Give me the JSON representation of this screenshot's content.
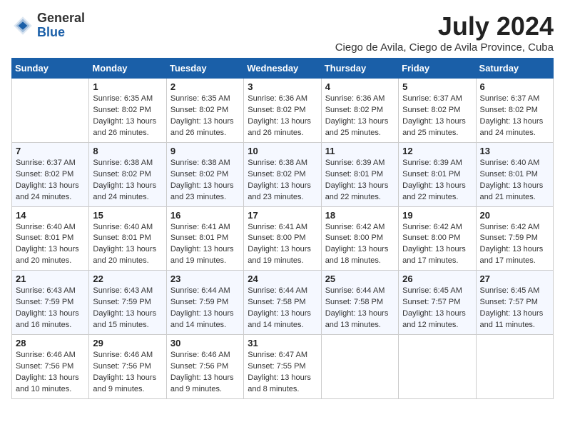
{
  "logo": {
    "general": "General",
    "blue": "Blue"
  },
  "title": "July 2024",
  "subtitle": "Ciego de Avila, Ciego de Avila Province, Cuba",
  "calendar": {
    "headers": [
      "Sunday",
      "Monday",
      "Tuesday",
      "Wednesday",
      "Thursday",
      "Friday",
      "Saturday"
    ],
    "weeks": [
      [
        {
          "day": "",
          "sunrise": "",
          "sunset": "",
          "daylight": ""
        },
        {
          "day": "1",
          "sunrise": "Sunrise: 6:35 AM",
          "sunset": "Sunset: 8:02 PM",
          "daylight": "Daylight: 13 hours and 26 minutes."
        },
        {
          "day": "2",
          "sunrise": "Sunrise: 6:35 AM",
          "sunset": "Sunset: 8:02 PM",
          "daylight": "Daylight: 13 hours and 26 minutes."
        },
        {
          "day": "3",
          "sunrise": "Sunrise: 6:36 AM",
          "sunset": "Sunset: 8:02 PM",
          "daylight": "Daylight: 13 hours and 26 minutes."
        },
        {
          "day": "4",
          "sunrise": "Sunrise: 6:36 AM",
          "sunset": "Sunset: 8:02 PM",
          "daylight": "Daylight: 13 hours and 25 minutes."
        },
        {
          "day": "5",
          "sunrise": "Sunrise: 6:37 AM",
          "sunset": "Sunset: 8:02 PM",
          "daylight": "Daylight: 13 hours and 25 minutes."
        },
        {
          "day": "6",
          "sunrise": "Sunrise: 6:37 AM",
          "sunset": "Sunset: 8:02 PM",
          "daylight": "Daylight: 13 hours and 24 minutes."
        }
      ],
      [
        {
          "day": "7",
          "sunrise": "Sunrise: 6:37 AM",
          "sunset": "Sunset: 8:02 PM",
          "daylight": "Daylight: 13 hours and 24 minutes."
        },
        {
          "day": "8",
          "sunrise": "Sunrise: 6:38 AM",
          "sunset": "Sunset: 8:02 PM",
          "daylight": "Daylight: 13 hours and 24 minutes."
        },
        {
          "day": "9",
          "sunrise": "Sunrise: 6:38 AM",
          "sunset": "Sunset: 8:02 PM",
          "daylight": "Daylight: 13 hours and 23 minutes."
        },
        {
          "day": "10",
          "sunrise": "Sunrise: 6:38 AM",
          "sunset": "Sunset: 8:02 PM",
          "daylight": "Daylight: 13 hours and 23 minutes."
        },
        {
          "day": "11",
          "sunrise": "Sunrise: 6:39 AM",
          "sunset": "Sunset: 8:01 PM",
          "daylight": "Daylight: 13 hours and 22 minutes."
        },
        {
          "day": "12",
          "sunrise": "Sunrise: 6:39 AM",
          "sunset": "Sunset: 8:01 PM",
          "daylight": "Daylight: 13 hours and 22 minutes."
        },
        {
          "day": "13",
          "sunrise": "Sunrise: 6:40 AM",
          "sunset": "Sunset: 8:01 PM",
          "daylight": "Daylight: 13 hours and 21 minutes."
        }
      ],
      [
        {
          "day": "14",
          "sunrise": "Sunrise: 6:40 AM",
          "sunset": "Sunset: 8:01 PM",
          "daylight": "Daylight: 13 hours and 20 minutes."
        },
        {
          "day": "15",
          "sunrise": "Sunrise: 6:40 AM",
          "sunset": "Sunset: 8:01 PM",
          "daylight": "Daylight: 13 hours and 20 minutes."
        },
        {
          "day": "16",
          "sunrise": "Sunrise: 6:41 AM",
          "sunset": "Sunset: 8:01 PM",
          "daylight": "Daylight: 13 hours and 19 minutes."
        },
        {
          "day": "17",
          "sunrise": "Sunrise: 6:41 AM",
          "sunset": "Sunset: 8:00 PM",
          "daylight": "Daylight: 13 hours and 19 minutes."
        },
        {
          "day": "18",
          "sunrise": "Sunrise: 6:42 AM",
          "sunset": "Sunset: 8:00 PM",
          "daylight": "Daylight: 13 hours and 18 minutes."
        },
        {
          "day": "19",
          "sunrise": "Sunrise: 6:42 AM",
          "sunset": "Sunset: 8:00 PM",
          "daylight": "Daylight: 13 hours and 17 minutes."
        },
        {
          "day": "20",
          "sunrise": "Sunrise: 6:42 AM",
          "sunset": "Sunset: 7:59 PM",
          "daylight": "Daylight: 13 hours and 17 minutes."
        }
      ],
      [
        {
          "day": "21",
          "sunrise": "Sunrise: 6:43 AM",
          "sunset": "Sunset: 7:59 PM",
          "daylight": "Daylight: 13 hours and 16 minutes."
        },
        {
          "day": "22",
          "sunrise": "Sunrise: 6:43 AM",
          "sunset": "Sunset: 7:59 PM",
          "daylight": "Daylight: 13 hours and 15 minutes."
        },
        {
          "day": "23",
          "sunrise": "Sunrise: 6:44 AM",
          "sunset": "Sunset: 7:59 PM",
          "daylight": "Daylight: 13 hours and 14 minutes."
        },
        {
          "day": "24",
          "sunrise": "Sunrise: 6:44 AM",
          "sunset": "Sunset: 7:58 PM",
          "daylight": "Daylight: 13 hours and 14 minutes."
        },
        {
          "day": "25",
          "sunrise": "Sunrise: 6:44 AM",
          "sunset": "Sunset: 7:58 PM",
          "daylight": "Daylight: 13 hours and 13 minutes."
        },
        {
          "day": "26",
          "sunrise": "Sunrise: 6:45 AM",
          "sunset": "Sunset: 7:57 PM",
          "daylight": "Daylight: 13 hours and 12 minutes."
        },
        {
          "day": "27",
          "sunrise": "Sunrise: 6:45 AM",
          "sunset": "Sunset: 7:57 PM",
          "daylight": "Daylight: 13 hours and 11 minutes."
        }
      ],
      [
        {
          "day": "28",
          "sunrise": "Sunrise: 6:46 AM",
          "sunset": "Sunset: 7:56 PM",
          "daylight": "Daylight: 13 hours and 10 minutes."
        },
        {
          "day": "29",
          "sunrise": "Sunrise: 6:46 AM",
          "sunset": "Sunset: 7:56 PM",
          "daylight": "Daylight: 13 hours and 9 minutes."
        },
        {
          "day": "30",
          "sunrise": "Sunrise: 6:46 AM",
          "sunset": "Sunset: 7:56 PM",
          "daylight": "Daylight: 13 hours and 9 minutes."
        },
        {
          "day": "31",
          "sunrise": "Sunrise: 6:47 AM",
          "sunset": "Sunset: 7:55 PM",
          "daylight": "Daylight: 13 hours and 8 minutes."
        },
        {
          "day": "",
          "sunrise": "",
          "sunset": "",
          "daylight": ""
        },
        {
          "day": "",
          "sunrise": "",
          "sunset": "",
          "daylight": ""
        },
        {
          "day": "",
          "sunrise": "",
          "sunset": "",
          "daylight": ""
        }
      ]
    ]
  }
}
